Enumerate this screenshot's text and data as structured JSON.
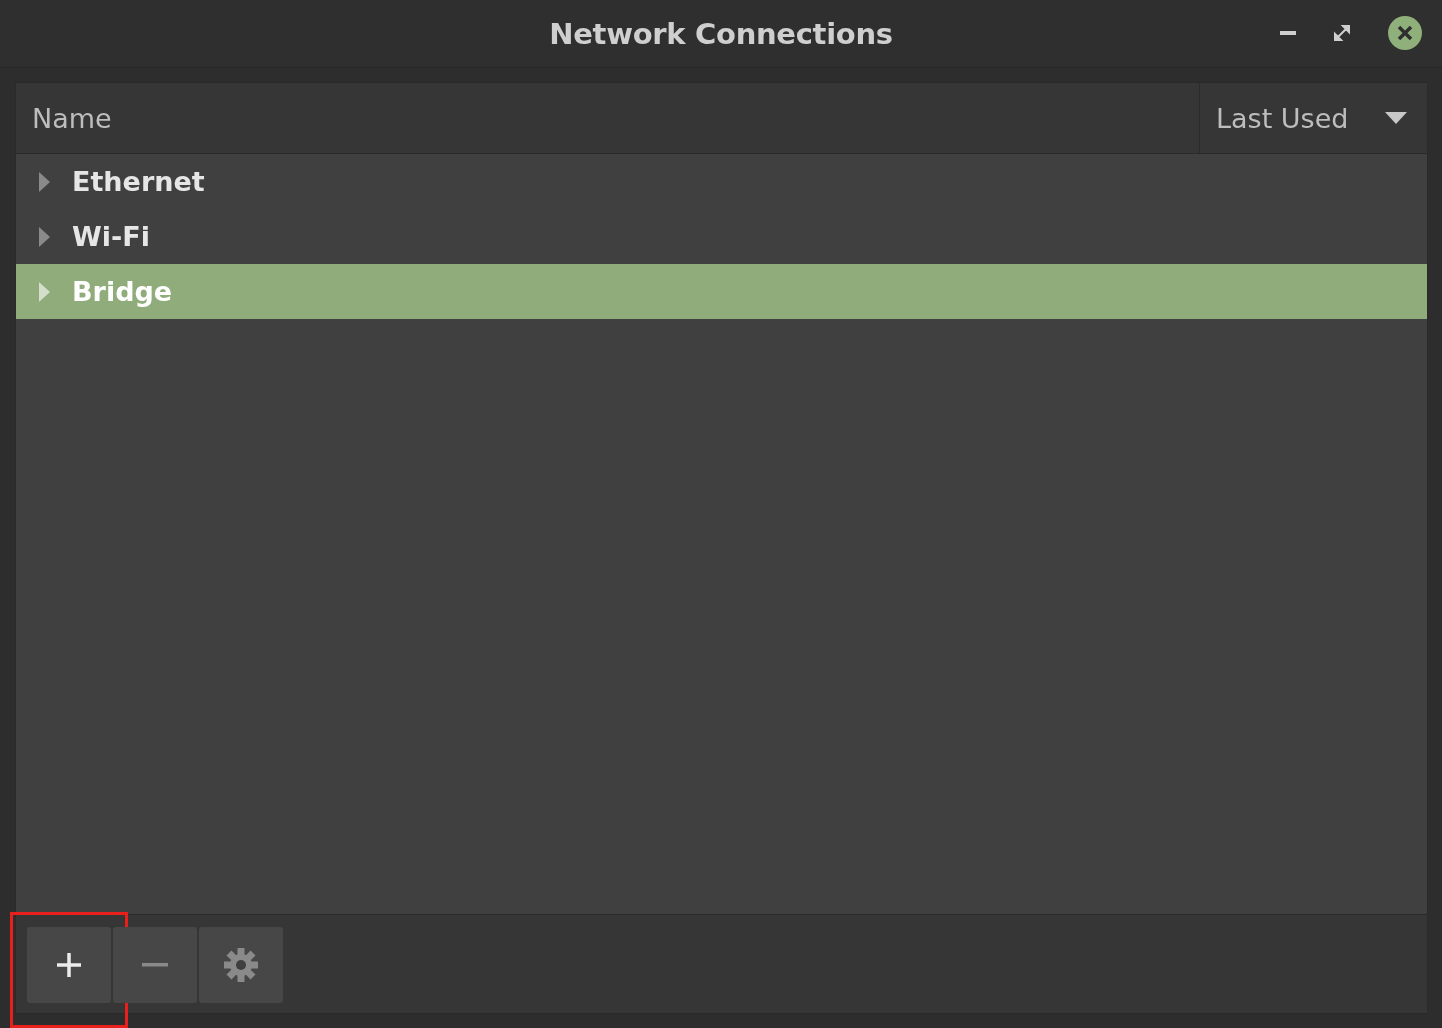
{
  "window": {
    "title": "Network Connections"
  },
  "columns": [
    {
      "label": "Name",
      "sorted": false
    },
    {
      "label": "Last Used",
      "sorted": true
    }
  ],
  "connections": [
    {
      "name": "Ethernet",
      "expanded": false,
      "selected": false
    },
    {
      "name": "Wi-Fi",
      "expanded": false,
      "selected": false
    },
    {
      "name": "Bridge",
      "expanded": false,
      "selected": true
    }
  ],
  "toolbar": [
    {
      "kind": "add",
      "highlighted": true
    },
    {
      "kind": "remove",
      "highlighted": false
    },
    {
      "kind": "settings",
      "highlighted": false
    }
  ]
}
